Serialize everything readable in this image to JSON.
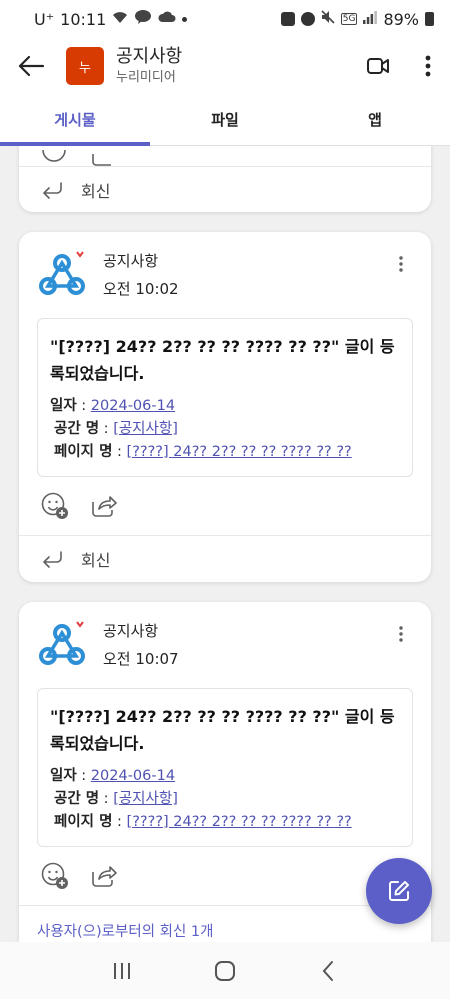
{
  "status_bar": {
    "carrier": "U⁺",
    "time": "10:11",
    "battery": "89%",
    "network": "5G"
  },
  "header": {
    "team_initial": "누",
    "channel_title": "공지사항",
    "team_name": "누리미디어",
    "avatar_color": "#d83b01"
  },
  "tabs": [
    {
      "label": "게시물",
      "active": true
    },
    {
      "label": "파일",
      "active": false
    },
    {
      "label": "앱",
      "active": false
    }
  ],
  "feed": {
    "reply_label": "회신",
    "posts": [
      {
        "author": "공지사항",
        "time": "오전 10:02",
        "title": "\"[????] 24?? 2?? ?? ?? ???? ?? ??\" 글이 등록되었습니다.",
        "date_label": "일자",
        "date_value": "2024-06-14",
        "space_label": "공간 명",
        "space_value": "[공지사항]",
        "page_label": "페이지 명",
        "page_value": "[????] 24?? 2?? ?? ?? ???? ?? ??"
      },
      {
        "author": "공지사항",
        "time": "오전 10:07",
        "title": "\"[????] 24?? 2?? ?? ?? ???? ?? ??\" 글이 등록되었습니다.",
        "date_label": "일자",
        "date_value": "2024-06-14",
        "space_label": "공간 명",
        "space_value": "[공지사항]",
        "page_label": "페이지 명",
        "page_value": "[????] 24?? 2?? ?? ?? ???? ?? ??",
        "reply_count": "사용자(으)로부터의 회신 1개"
      }
    ]
  },
  "colors": {
    "accent": "#5b5fc7",
    "link": "#4f52b2"
  }
}
